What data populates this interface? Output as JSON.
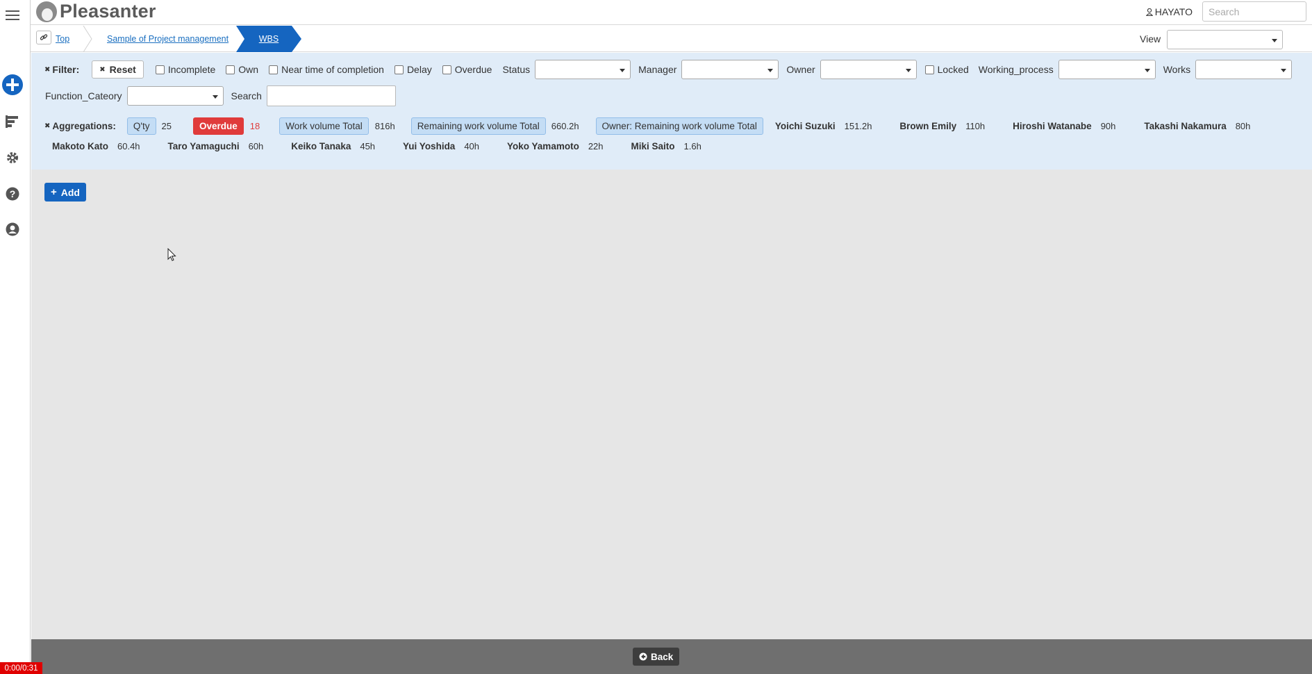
{
  "app": {
    "name": "Pleasanter"
  },
  "header": {
    "user": "HAYATO",
    "search_placeholder": "Search"
  },
  "breadcrumb": {
    "items": [
      "Top",
      "Sample of Project management",
      "WBS"
    ]
  },
  "view": {
    "label": "View",
    "value": ""
  },
  "filter": {
    "label": "Filter:",
    "reset_label": "Reset",
    "checkboxes": [
      "Incomplete",
      "Own",
      "Near time of completion",
      "Delay",
      "Overdue"
    ],
    "status_label": "Status",
    "manager_label": "Manager",
    "owner_label": "Owner",
    "locked_label": "Locked",
    "working_process_label": "Working_process",
    "works_label": "Works",
    "function_category_label": "Function_Cateory",
    "search_label": "Search"
  },
  "aggregations": {
    "label": "Aggregations:",
    "qty_label": "Q'ty",
    "qty_value": "25",
    "overdue_label": "Overdue",
    "overdue_value": "18",
    "work_volume_label": "Work volume Total",
    "work_volume_value": "816h",
    "remaining_label": "Remaining work volume Total",
    "remaining_value": "660.2h",
    "owner_remaining_label": "Owner: Remaining work volume Total",
    "people": [
      {
        "name": "Yoichi Suzuki",
        "value": "151.2h"
      },
      {
        "name": "Brown Emily",
        "value": "110h"
      },
      {
        "name": "Hiroshi Watanabe",
        "value": "90h"
      },
      {
        "name": "Takashi Nakamura",
        "value": "80h"
      },
      {
        "name": "Makoto Kato",
        "value": "60.4h"
      },
      {
        "name": "Taro Yamaguchi",
        "value": "60h"
      },
      {
        "name": "Keiko Tanaka",
        "value": "45h"
      },
      {
        "name": "Yui Yoshida",
        "value": "40h"
      },
      {
        "name": "Yoko Yamamoto",
        "value": "22h"
      },
      {
        "name": "Miki Saito",
        "value": "1.6h"
      }
    ]
  },
  "main": {
    "add_label": "Add"
  },
  "footer": {
    "back_label": "Back"
  },
  "timer": "0:00/0:31",
  "colors": {
    "accent": "#1565c0",
    "panel": "#e0ecf8",
    "overdue": "#e03b3b",
    "footer": "#6f6f6f"
  }
}
